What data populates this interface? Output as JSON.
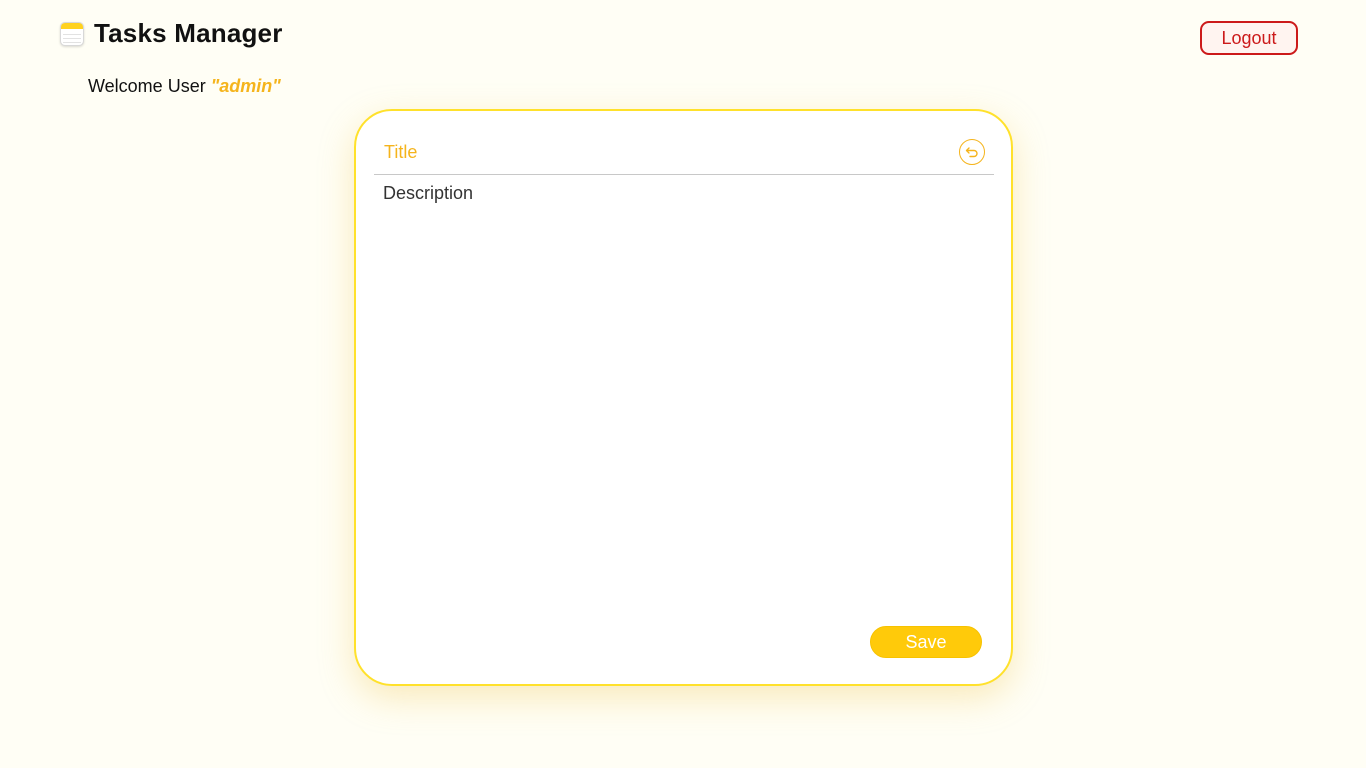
{
  "app": {
    "title": "Tasks Manager",
    "icon": "notepad-icon"
  },
  "welcome": {
    "prefix": "Welcome User ",
    "username": "\"admin\""
  },
  "header": {
    "logout_label": "Logout"
  },
  "editor": {
    "title_placeholder": "Title",
    "description_placeholder": "Description",
    "back_icon": "undo-arrow-icon",
    "save_label": "Save"
  },
  "colors": {
    "background": "#fffef5",
    "accent": "#f5b41c",
    "card_border": "#ffe12b",
    "save_button": "#ffca0a",
    "logout": "#cc1a1a"
  }
}
